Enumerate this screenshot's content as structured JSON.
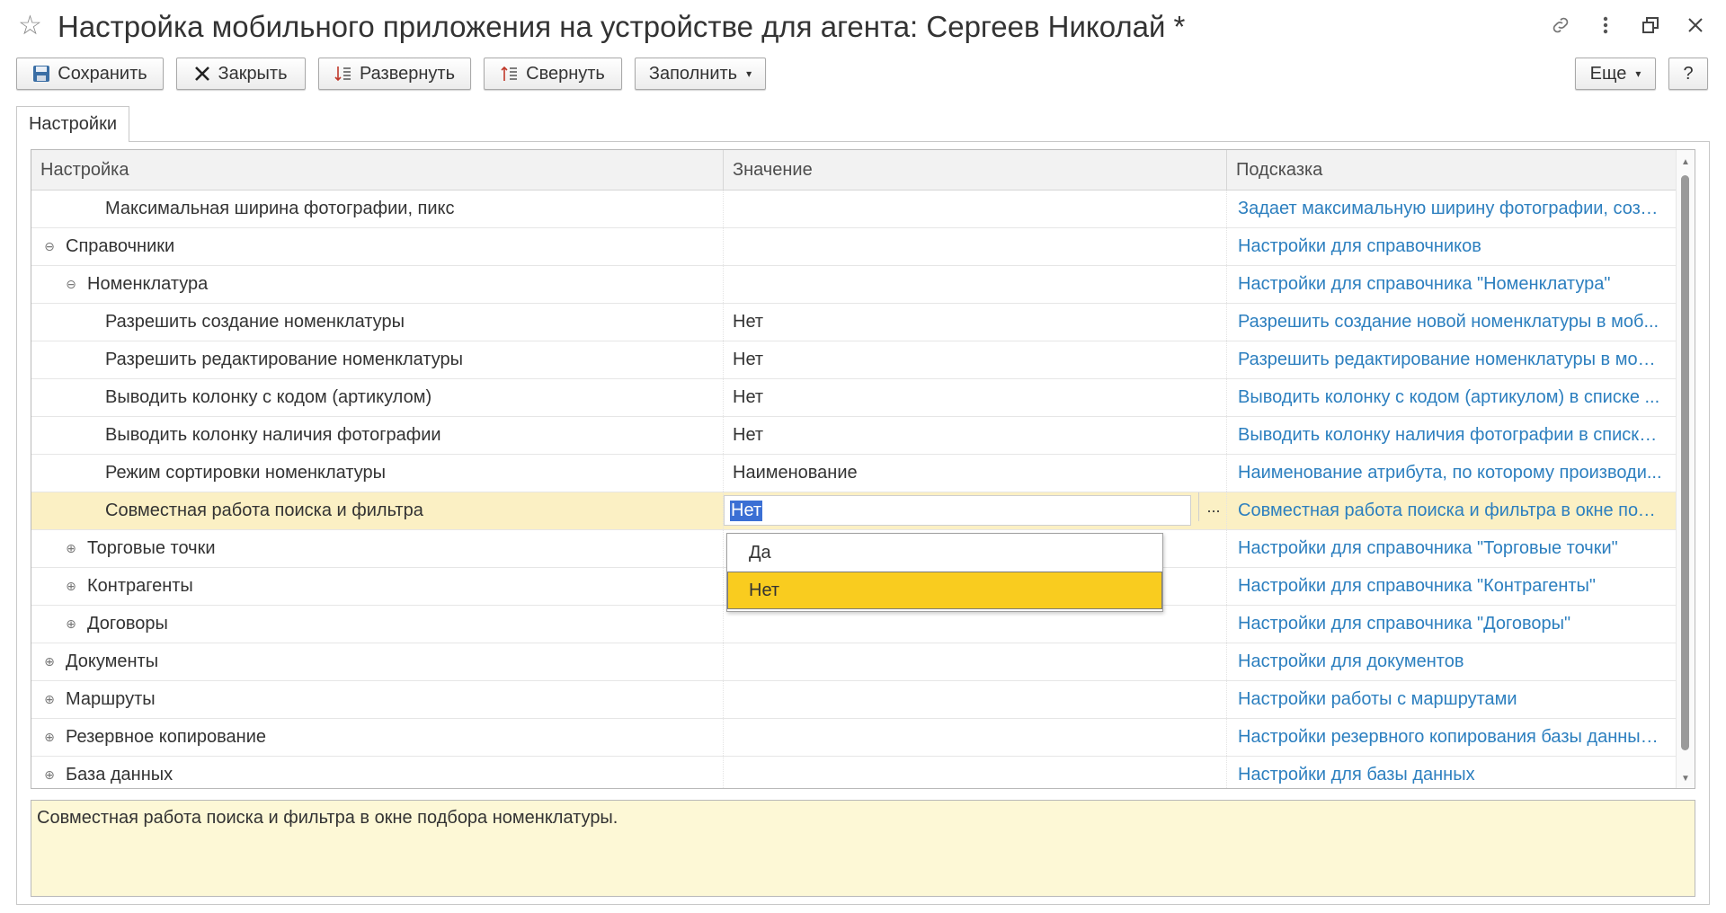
{
  "window": {
    "title": "Настройка мобильного приложения на устройстве для агента: Сергеев Николай *",
    "icons": [
      "star-icon",
      "link-icon",
      "more-vertical-icon",
      "restore-icon",
      "close-icon"
    ]
  },
  "toolbar": {
    "save": "Сохранить",
    "close": "Закрыть",
    "expand": "Развернуть",
    "collapse": "Свернуть",
    "fill": "Заполнить",
    "more": "Еще",
    "help": "?"
  },
  "tabs": [
    {
      "label": "Настройки",
      "active": true
    }
  ],
  "grid": {
    "columns": [
      "Настройка",
      "Значение",
      "Подсказка"
    ],
    "rows": [
      {
        "setting": "Максимальная ширина фотографии, пикс",
        "value": "",
        "hint": "Задает максимальную ширину фотографии, созд...",
        "level": 3,
        "tree": ""
      },
      {
        "setting": "Справочники",
        "value": "",
        "hint": "Настройки для справочников",
        "level": 1,
        "tree": "⊖"
      },
      {
        "setting": "Номенклатура",
        "value": "",
        "hint": "Настройки для справочника \"Номенклатура\"",
        "level": 2,
        "tree": "⊖"
      },
      {
        "setting": "Разрешить создание номенклатуры",
        "value": "Нет",
        "hint": "Разрешить создание новой номенклатуры в моб...",
        "level": 3,
        "tree": ""
      },
      {
        "setting": "Разрешить редактирование номенклатуры",
        "value": "Нет",
        "hint": "Разрешить редактирование номенклатуры в моб...",
        "level": 3,
        "tree": ""
      },
      {
        "setting": "Выводить колонку с кодом (артикулом)",
        "value": "Нет",
        "hint": "Выводить колонку с кодом (артикулом) в списке ...",
        "level": 3,
        "tree": ""
      },
      {
        "setting": "Выводить колонку наличия фотографии",
        "value": "Нет",
        "hint": "Выводить колонку наличия фотографии в списке...",
        "level": 3,
        "tree": ""
      },
      {
        "setting": "Режим сортировки номенклатуры",
        "value": "Наименование",
        "hint": "Наименование атрибута, по которому производи...",
        "level": 3,
        "tree": ""
      },
      {
        "setting": "Совместная работа поиска и фильтра",
        "value": "Нет",
        "hint": "Совместная работа поиска и фильтра в окне под...",
        "level": 3,
        "tree": "",
        "selected": true
      },
      {
        "setting": "Торговые точки",
        "value": "",
        "hint": "Настройки для справочника \"Торговые точки\"",
        "level": 2,
        "tree": "⊕"
      },
      {
        "setting": "Контрагенты",
        "value": "",
        "hint": "Настройки для справочника \"Контрагенты\"",
        "level": 2,
        "tree": "⊕"
      },
      {
        "setting": "Договоры",
        "value": "",
        "hint": "Настройки для справочника \"Договоры\"",
        "level": 2,
        "tree": "⊕"
      },
      {
        "setting": "Документы",
        "value": "",
        "hint": "Настройки для документов",
        "level": 1,
        "tree": "⊕"
      },
      {
        "setting": "Маршруты",
        "value": "",
        "hint": "Настройки работы с маршрутами",
        "level": 1,
        "tree": "⊕"
      },
      {
        "setting": "Резервное копирование",
        "value": "",
        "hint": "Настройки резервного копирования базы данных...",
        "level": 1,
        "tree": "⊕"
      },
      {
        "setting": "База данных",
        "value": "",
        "hint": "Настройки для базы данных",
        "level": 1,
        "tree": "⊕"
      }
    ],
    "edit_dots": "..."
  },
  "dropdown": {
    "options": [
      "Да",
      "Нет"
    ],
    "selected": "Нет"
  },
  "hint_text": "Совместная работа поиска и фильтра в окне подбора номенклатуры.",
  "colors": {
    "link": "#2c7fbf",
    "selected_row": "#fbf0c4",
    "dropdown_active": "#f9cc1f",
    "hint_bg": "#fdf8d6"
  }
}
